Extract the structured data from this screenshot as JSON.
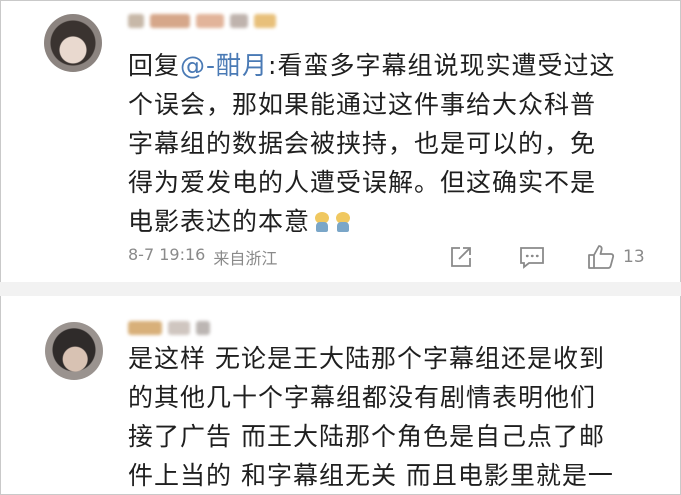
{
  "comments": [
    {
      "text_prefix": "回复",
      "mention": "@-酣月",
      "text": ":看蛮多字幕组说现实遭受过这\n个误会，那如果能通过这件事给大众科普\n字幕组的数据会被挟持，也是可以的，免\n得为爱发电的人遭受误解。但这确实不是\n电影表达的本意",
      "emojis": [
        "sweat-emoji",
        "sweat-emoji"
      ],
      "date": "8-7 19:16",
      "location": "来自浙江",
      "likes": "13"
    },
    {
      "text": "是这样 无论是王大陆那个字幕组还是收到\n的其他几十个字幕组都没有剧情表明他们\n接了广告 而王大陆那个角色是自己点了邮\n件上当的 和字幕组无关 而且电影里就是一"
    }
  ],
  "icons": {
    "share": "share-icon",
    "comment": "comment-icon",
    "like": "thumbs-up-icon"
  },
  "colors": {
    "mention": "#4a7ab5",
    "meta_gray": "#8a8a8a",
    "separator": "#f2f2f2"
  }
}
